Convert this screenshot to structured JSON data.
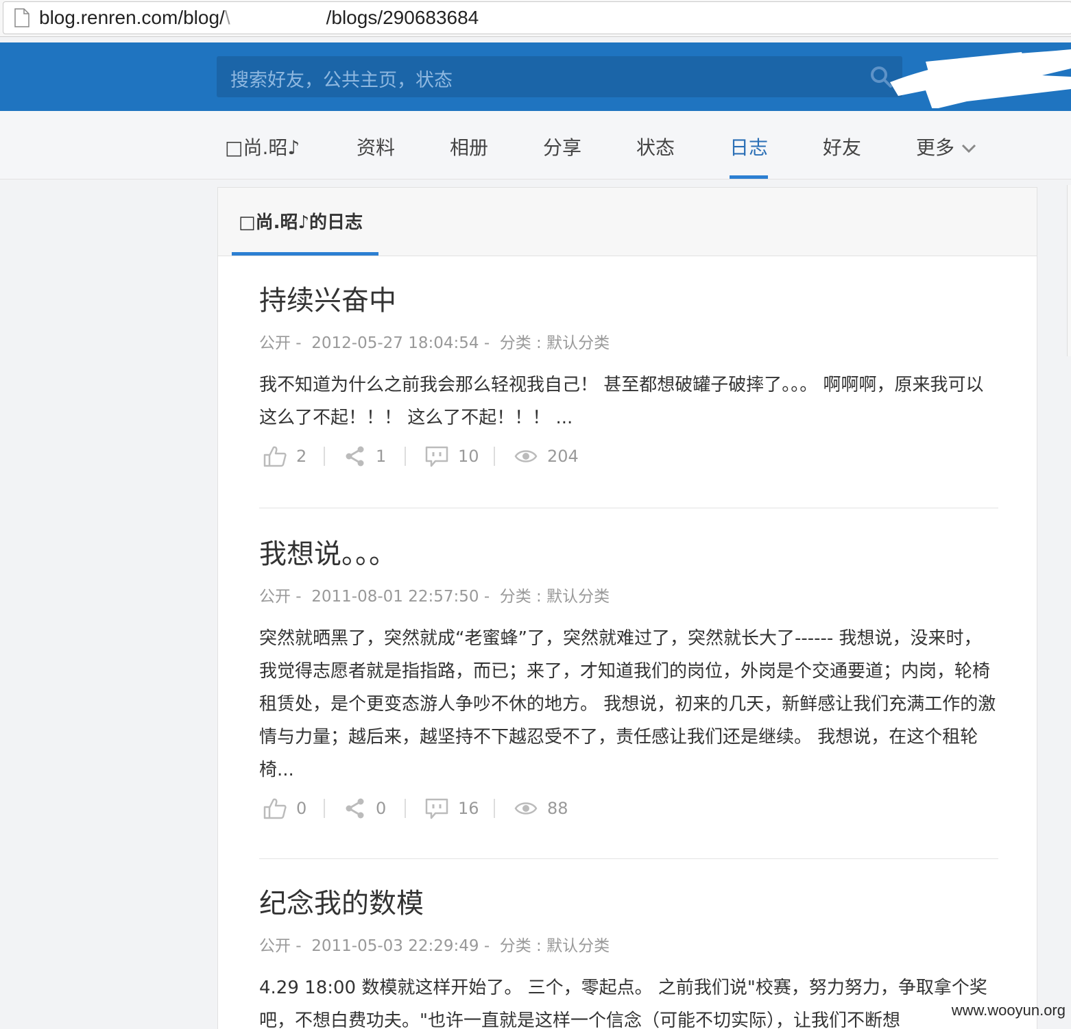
{
  "browser": {
    "url_prefix": "blog.renren.com/blog/",
    "url_obscured": "\\",
    "url_suffix": "/blogs/290683684"
  },
  "header": {
    "search_placeholder": "搜索好友，公共主页，状态"
  },
  "nav": {
    "items": [
      {
        "label": "□尚.昭♪"
      },
      {
        "label": "资料"
      },
      {
        "label": "相册"
      },
      {
        "label": "分享"
      },
      {
        "label": "状态"
      },
      {
        "label": "日志"
      },
      {
        "label": "好友"
      },
      {
        "label": "更多"
      }
    ],
    "active": "日志"
  },
  "blog": {
    "heading": "□尚.昭♪的日志",
    "entries": [
      {
        "title": "持续兴奋中",
        "meta": "公开 -  2012-05-27 18:04:54 -  分类 : 默认分类",
        "body": "我不知道为什么之前我会那么轻视我自己！ 甚至都想破罐子破摔了。。。 啊啊啊，原来我可以这么了不起！！！ 这么了不起！！！ ...",
        "likes": "2",
        "shares": "1",
        "comments": "10",
        "views": "204"
      },
      {
        "title": "我想说。。。",
        "meta": "公开 -  2011-08-01 22:57:50 -  分类 : 默认分类",
        "body": "突然就晒黑了，突然就成“老蜜蜂”了，突然就难过了，突然就长大了------ 我想说，没来时，我觉得志愿者就是指指路，而已；来了，才知道我们的岗位，外岗是个交通要道；内岗，轮椅租赁处，是个更变态游人争吵不休的地方。 我想说，初来的几天，新鲜感让我们充满工作的激情与力量；越后来，越坚持不下越忍受不了，责任感让我们还是继续。 我想说，在这个租轮椅...",
        "likes": "0",
        "shares": "0",
        "comments": "16",
        "views": "88"
      },
      {
        "title": "纪念我的数模",
        "meta": "公开 -  2011-05-03 22:29:49 -  分类 : 默认分类",
        "body": "4.29 18:00 数模就这样开始了。 三个，零起点。 之前我们说\"校赛，努力努力，争取拿个奖吧，不想白费功夫。\"也许一直就是这样一个信念（可能不切实际），让我们不断想"
      }
    ]
  },
  "watermark": "www.wooyun.org"
}
